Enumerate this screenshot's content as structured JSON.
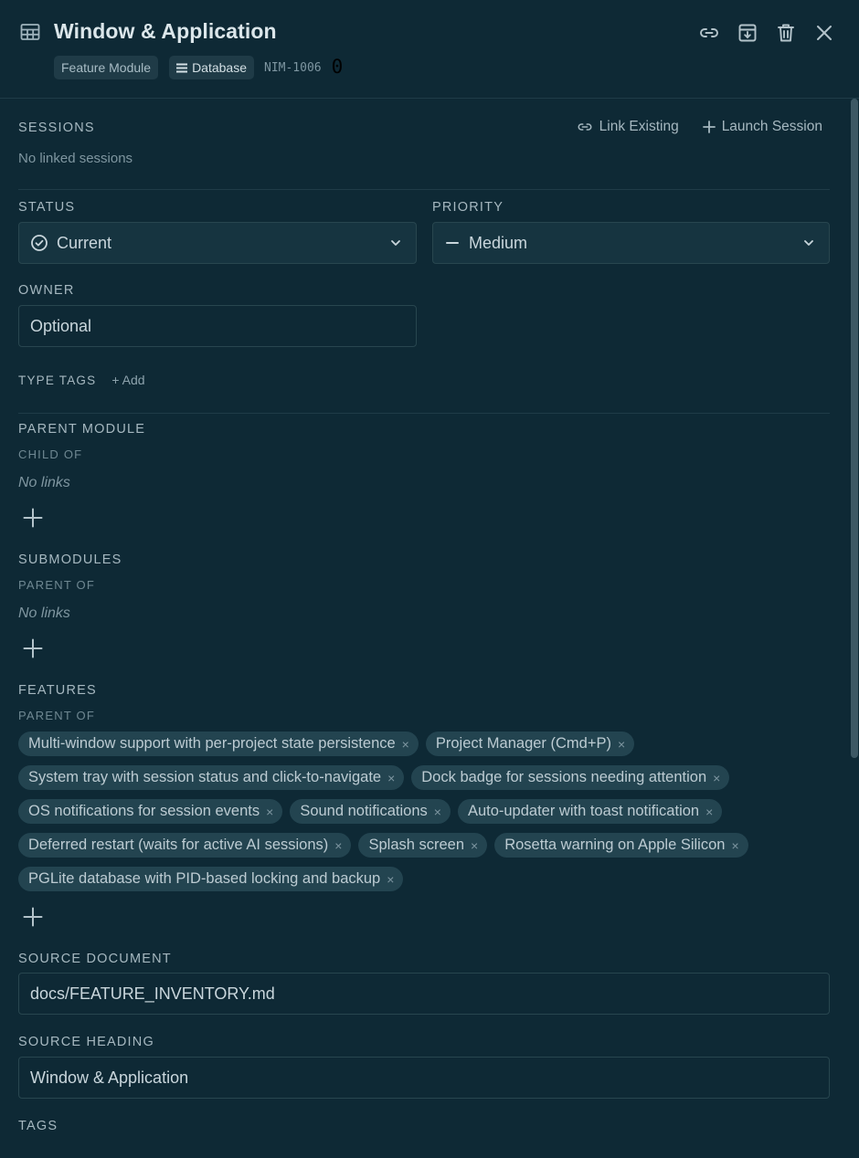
{
  "header": {
    "title": "Window & Application",
    "type_chip": "Feature Module",
    "db_chip": "Database",
    "identifier": "NIM-1006",
    "counter": "0"
  },
  "sessions": {
    "label": "SESSIONS",
    "link_existing": "Link Existing",
    "launch_session": "Launch Session",
    "empty": "No linked sessions"
  },
  "status": {
    "label": "STATUS",
    "value": "Current"
  },
  "priority": {
    "label": "PRIORITY",
    "value": "Medium"
  },
  "owner": {
    "label": "OWNER",
    "placeholder": "Optional"
  },
  "type_tags": {
    "label": "TYPE TAGS",
    "add": "+ Add"
  },
  "parent_module": {
    "label": "PARENT MODULE",
    "sublabel": "CHILD OF",
    "empty": "No links"
  },
  "submodules": {
    "label": "SUBMODULES",
    "sublabel": "PARENT OF",
    "empty": "No links"
  },
  "features": {
    "label": "FEATURES",
    "sublabel": "PARENT OF",
    "items": [
      "Multi-window support with per-project state persistence",
      "Project Manager (Cmd+P)",
      "System tray with session status and click-to-navigate",
      "Dock badge for sessions needing attention",
      "OS notifications for session events",
      "Sound notifications",
      "Auto-updater with toast notification",
      "Deferred restart (waits for active AI sessions)",
      "Splash screen",
      "Rosetta warning on Apple Silicon",
      "PGLite database with PID-based locking and backup"
    ],
    "remove_glyph": "×"
  },
  "source_document": {
    "label": "SOURCE DOCUMENT",
    "value": "docs/FEATURE_INVENTORY.md"
  },
  "source_heading": {
    "label": "SOURCE HEADING",
    "value": "Window & Application"
  },
  "tags": {
    "label": "TAGS"
  },
  "icons": {
    "title": "grid-icon",
    "actions": [
      "link-icon",
      "archive-icon",
      "trash-icon",
      "close-icon"
    ]
  },
  "colors": {
    "background": "#0e2935",
    "chip": "#1f3b47",
    "tag": "#234450",
    "border": "#28464f"
  }
}
